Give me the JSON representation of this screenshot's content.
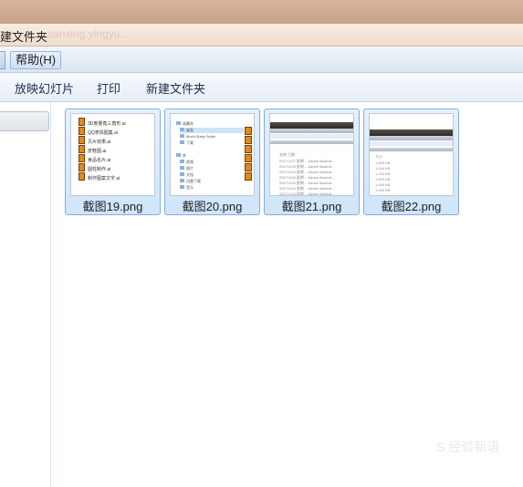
{
  "window": {
    "title_fragment": "建文件夹",
    "ghost_text": "sanxing.yingyu..."
  },
  "menubar": {
    "help": "帮助(H)"
  },
  "toolbar": {
    "slideshow": "放映幻灯片",
    "print": "打印",
    "new_folder": "新建文件夹"
  },
  "files": [
    {
      "name": "截图19.png"
    },
    {
      "name": "截图20.png"
    },
    {
      "name": "截图21.png"
    },
    {
      "name": "截图22.png"
    }
  ],
  "thumb19_rows": [
    "3D度量角三角形.ai",
    "QQ表情图集.ai",
    "贝片效果.ai",
    "皮鞋图.ai",
    "食品名片.ai",
    "圆柱制作.ai",
    "制作图案文字.ai"
  ],
  "thumb20_rows": [
    "收藏夹",
    "桌面",
    "Mochi Baby Seller",
    "下载",
    "",
    "库",
    "视频",
    "图片",
    "文档",
    "迅雷下载",
    "音乐"
  ],
  "thumb21_rows": [
    "名称        日期",
    "2017/1/27 星期...  Adobe Illustrat...",
    "2017/1/25 星期...  Adobe Illustrat...",
    "2017/1/26 星期...  Adobe Illustrat...",
    "2017/1/26 星期...  Adobe Illustrat...",
    "2017/1/24 星期...  Adobe Illustrat...",
    "2017/1/24 星期...  Adobe Illustrat...",
    "2017/1/26 星期...  Adobe Illustrat..."
  ],
  "thumb22_rows": [
    "大小",
    "1,153 KB",
    "1,044 KB",
    "1,216 KB",
    "1,093 KB",
    "1,049 KB",
    "1,009 KB"
  ],
  "watermark": {
    "main": "S 经验新语",
    "sub": ""
  }
}
